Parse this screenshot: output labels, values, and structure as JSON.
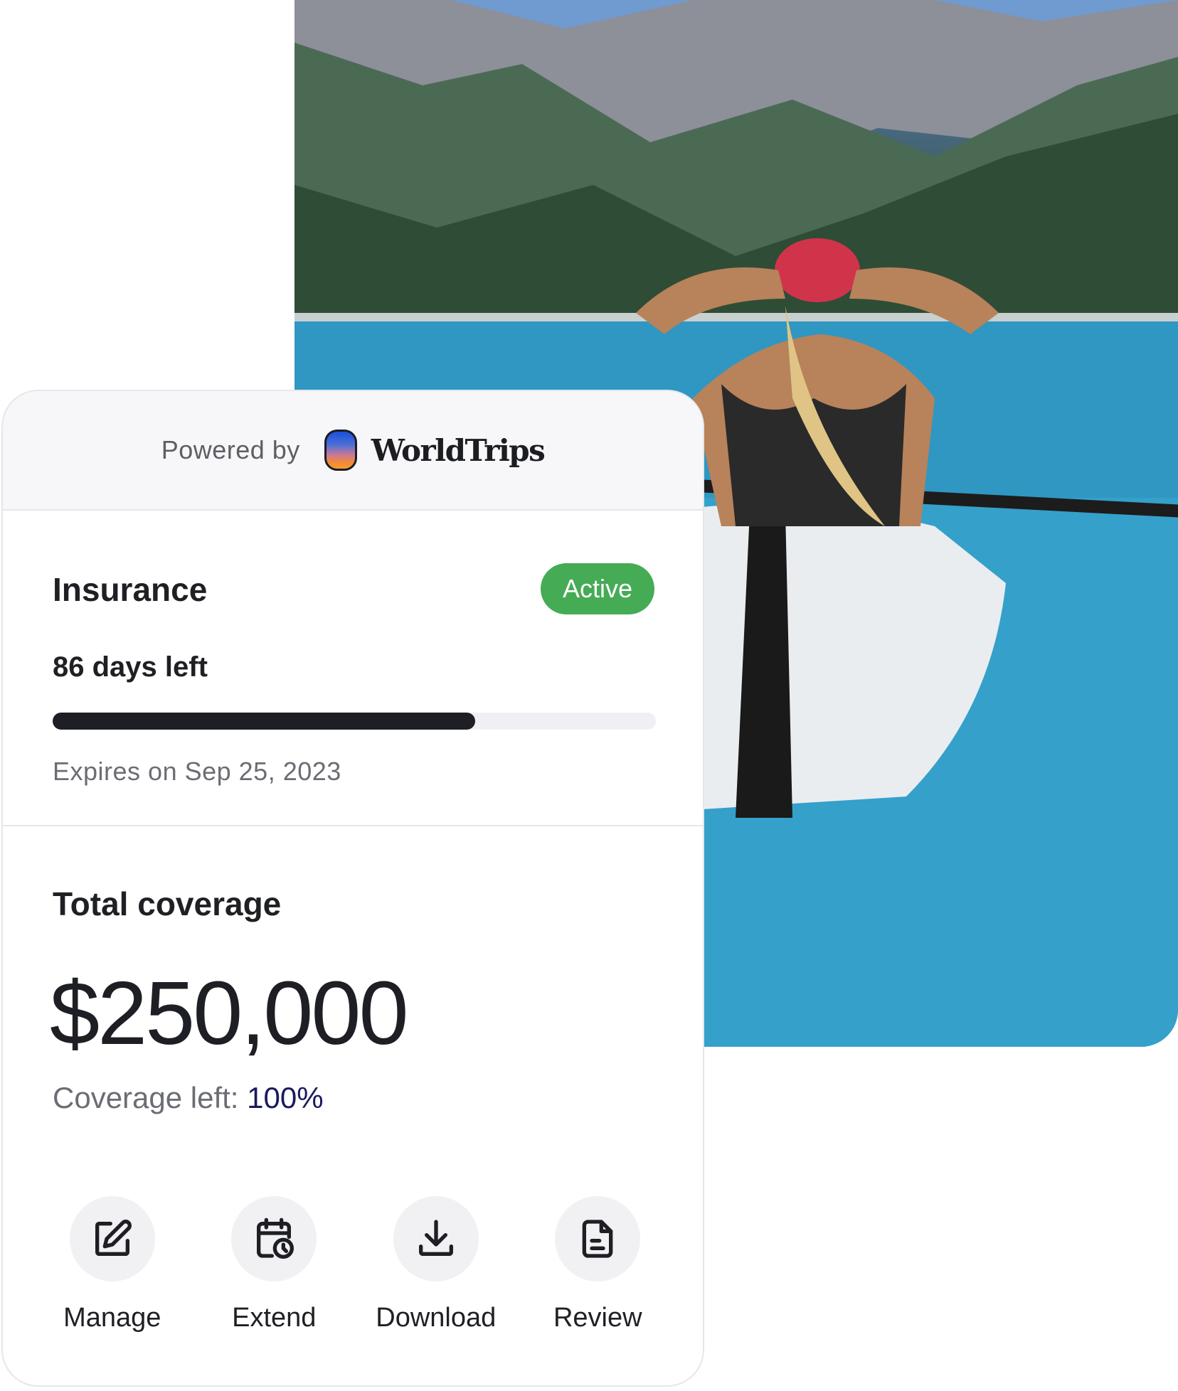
{
  "header": {
    "powered_by": "Powered by",
    "brand_name": "WorldTrips"
  },
  "insurance": {
    "title": "Insurance",
    "status": "Active",
    "days_left": "86 days left",
    "progress_fraction": 0.7,
    "expires": "Expires on Sep 25, 2023"
  },
  "coverage": {
    "title": "Total coverage",
    "amount": "$250,000",
    "left_label": "Coverage left:",
    "left_value": "100%"
  },
  "actions": [
    {
      "label": "Manage",
      "icon": "edit-icon"
    },
    {
      "label": "Extend",
      "icon": "calendar-clock-icon"
    },
    {
      "label": "Download",
      "icon": "download-icon"
    },
    {
      "label": "Review",
      "icon": "document-icon"
    }
  ],
  "colors": {
    "active_badge": "#45ab55",
    "progress_fill": "#1d1f24",
    "coverage_left_value": "#1a1a5e"
  }
}
